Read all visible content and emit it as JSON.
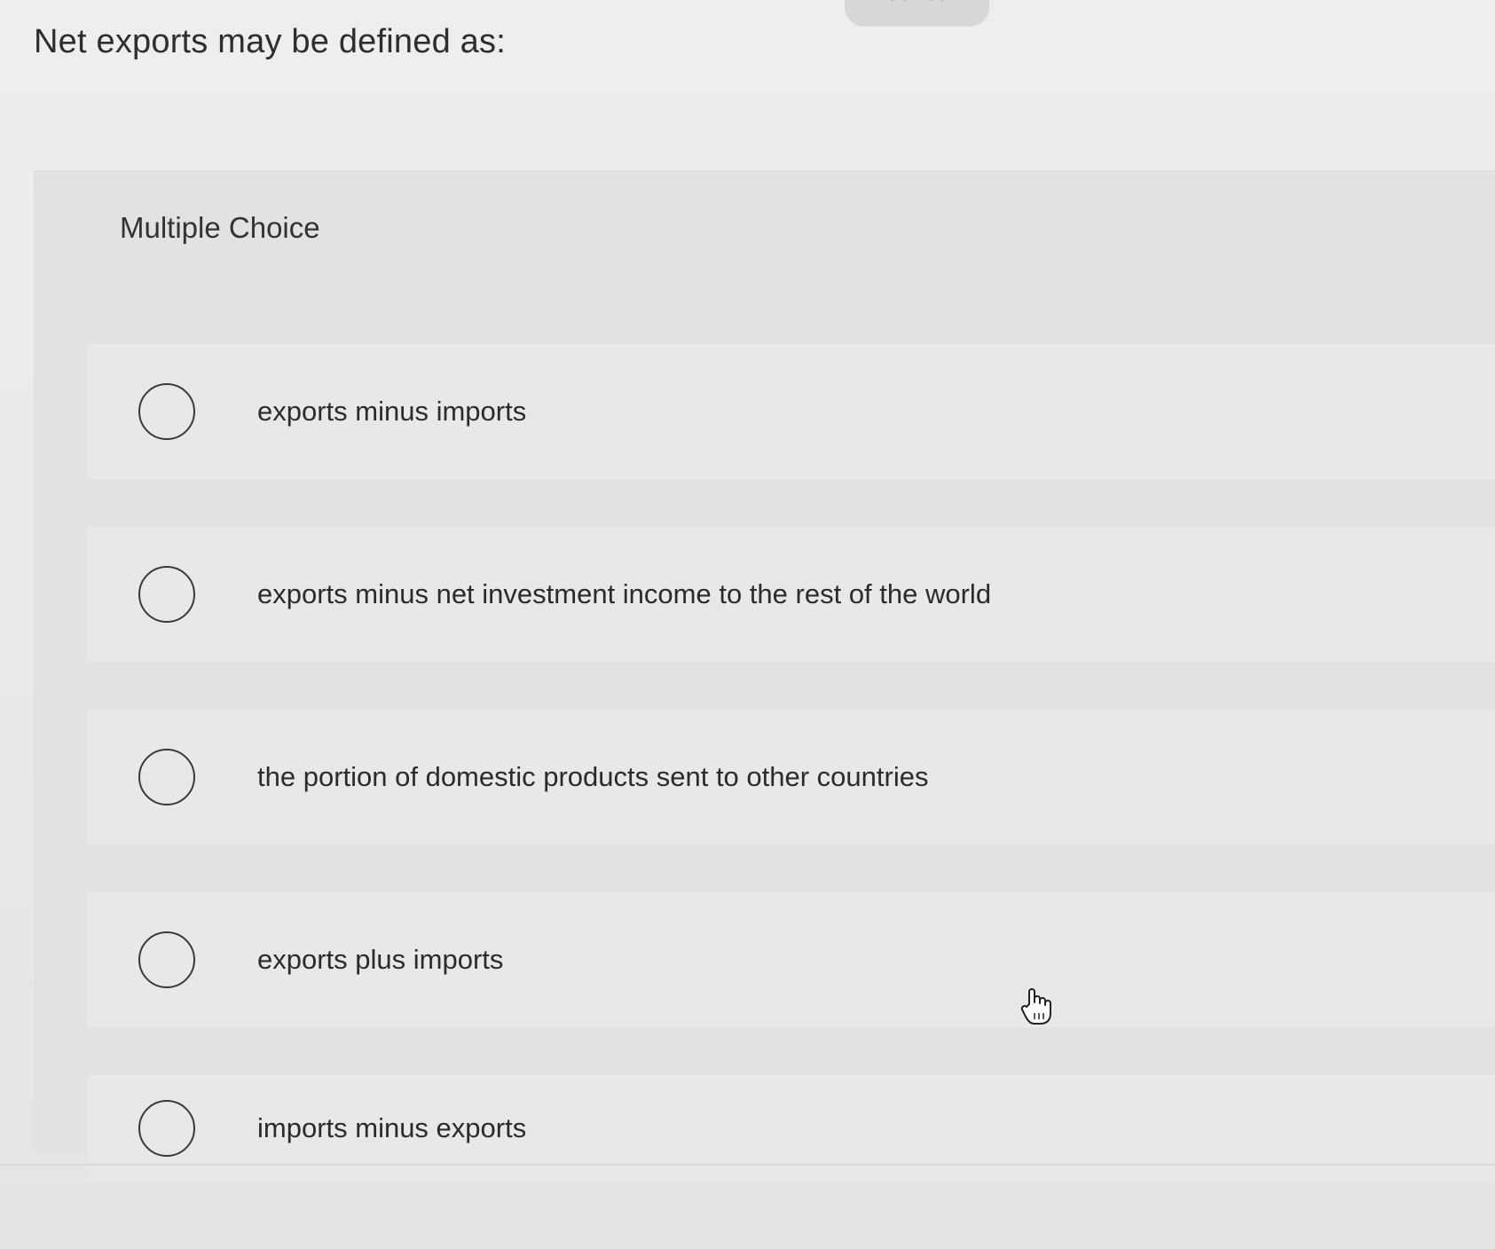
{
  "header": {
    "saved_label": "Saved"
  },
  "question": {
    "prompt": "Net exports may be defined as:",
    "type_label": "Multiple Choice",
    "options": [
      {
        "label": "exports minus imports"
      },
      {
        "label": "exports minus net investment income to the rest of the world"
      },
      {
        "label": "the portion of domestic products sent to other countries"
      },
      {
        "label": "exports plus imports"
      },
      {
        "label": "imports minus exports"
      }
    ]
  },
  "colors": {
    "background": "#e9e9e7",
    "panel": "#e2e2e0",
    "text": "#2b2b2b",
    "radio_border": "#3a3a3a"
  },
  "icons": {
    "cursor": "hand-pointer-icon"
  }
}
